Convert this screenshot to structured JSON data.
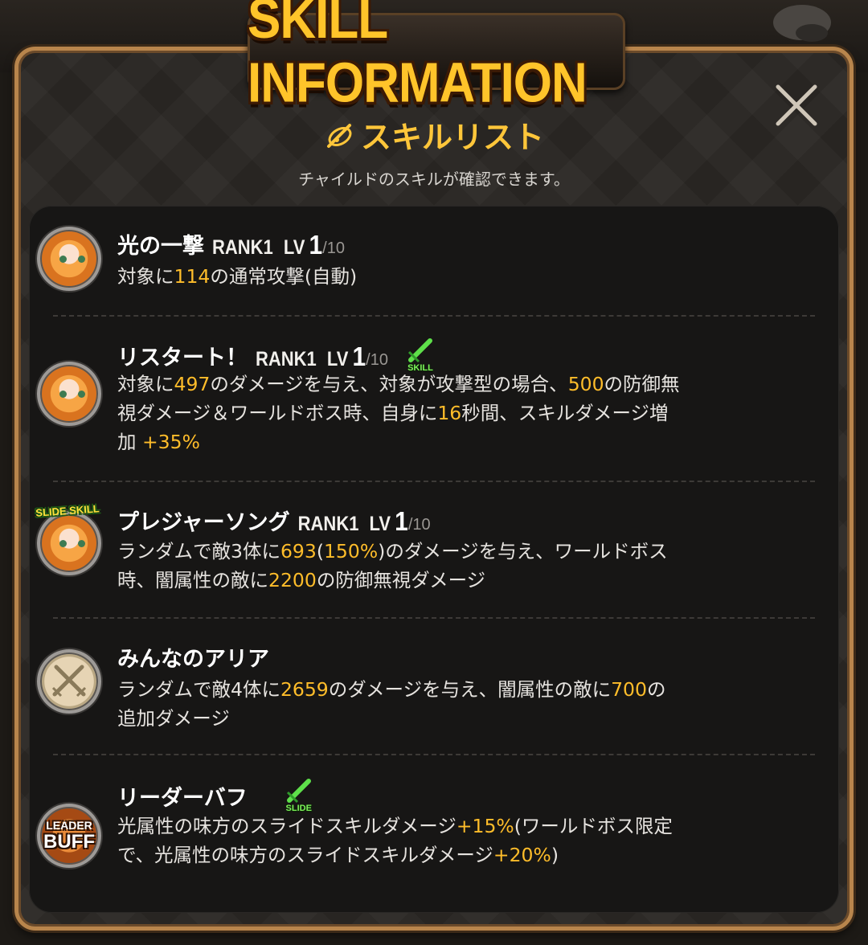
{
  "window": {
    "title": "SKILL INFORMATION"
  },
  "header": {
    "title": "スキルリスト",
    "subtitle": "チャイルドのスキルが確認できます。"
  },
  "skills": [
    {
      "name": "光の一撃",
      "rank": "RANK1",
      "lv_prefix": "LV",
      "lv": "1",
      "lv_max": "/10",
      "icon": "character-portrait-icon",
      "badge": null,
      "desc": [
        {
          "t": "対象に"
        },
        {
          "t": "114",
          "hl": true
        },
        {
          "t": "の通常攻撃(自動)"
        }
      ]
    },
    {
      "name": "リスタート！",
      "rank": "RANK1",
      "lv_prefix": "LV",
      "lv": "1",
      "lv_max": "/10",
      "icon": "character-portrait-icon",
      "badge": "SKILL",
      "desc": [
        {
          "t": "対象に"
        },
        {
          "t": "497",
          "hl": true
        },
        {
          "t": "のダメージを与え、対象が攻撃型の場合、"
        },
        {
          "t": "500",
          "hl": true
        },
        {
          "t": "の防御無視ダメージ＆ワールドボス時、自身に"
        },
        {
          "t": "16",
          "hl": true
        },
        {
          "t": "秒間、スキルダメージ増加 "
        },
        {
          "t": "+35%",
          "hl": true
        }
      ]
    },
    {
      "name": "プレジャーソング",
      "rank": "RANK1",
      "lv_prefix": "LV",
      "lv": "1",
      "lv_max": "/10",
      "icon": "character-portrait-icon",
      "icon_tag": "SLIDE SKILL",
      "badge": null,
      "desc": [
        {
          "t": "ランダムで敵3体に"
        },
        {
          "t": "693",
          "hl": true
        },
        {
          "t": "("
        },
        {
          "t": "150%",
          "hl": true
        },
        {
          "t": ")のダメージを与え、ワールドボス時、闇属性の敵に"
        },
        {
          "t": "2200",
          "hl": true
        },
        {
          "t": "の防御無視ダメージ"
        }
      ]
    },
    {
      "name": "みんなのアリア",
      "rank": "",
      "lv_prefix": "",
      "lv": "",
      "lv_max": "",
      "icon": "crossed-swords-icon",
      "badge": null,
      "desc": [
        {
          "t": "ランダムで敵4体に"
        },
        {
          "t": "2659",
          "hl": true
        },
        {
          "t": "のダメージを与え、闇属性の敵に"
        },
        {
          "t": "700",
          "hl": true
        },
        {
          "t": "の追加ダメージ"
        }
      ]
    },
    {
      "name": "リーダーバフ",
      "rank": "",
      "lv_prefix": "",
      "lv": "",
      "lv_max": "",
      "icon": "leader-buff-icon",
      "icon_label_top": "LEADER",
      "icon_label_bottom": "BUFF",
      "badge": "SLIDE",
      "desc": [
        {
          "t": "光属性の味方のスライドスキルダメージ"
        },
        {
          "t": "+15%",
          "hl": true
        },
        {
          "t": "(ワールドボス限定で、光属性の味方のスライドスキルダメージ"
        },
        {
          "t": "+20%",
          "hl": true
        },
        {
          "t": ")"
        }
      ]
    }
  ],
  "colors": {
    "accent": "#ffbd2a",
    "title": "#ffc42a",
    "frame": "#b8854c",
    "badge_green": "#7cf05a"
  }
}
